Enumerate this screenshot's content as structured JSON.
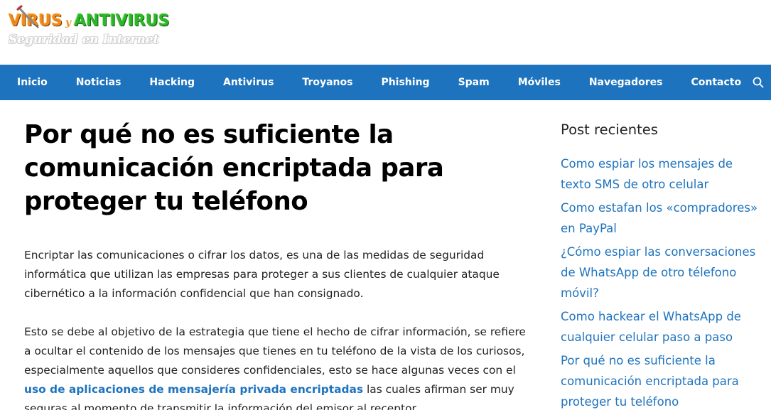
{
  "site": {
    "logo_word1": "VIRUS",
    "logo_joiner": "y",
    "logo_word2": "ANTIVIRUS",
    "tagline": "Seguridad en Internet"
  },
  "colors": {
    "nav_bg": "#1e73be",
    "link": "#1e73be",
    "logo_orange": "#f28a1a",
    "logo_green": "#2fb52a"
  },
  "nav": {
    "items": [
      {
        "label": "Inicio"
      },
      {
        "label": "Noticias"
      },
      {
        "label": "Hacking"
      },
      {
        "label": "Antivirus"
      },
      {
        "label": "Troyanos"
      },
      {
        "label": "Phishing"
      },
      {
        "label": "Spam"
      },
      {
        "label": "Móviles"
      },
      {
        "label": "Navegadores"
      },
      {
        "label": "Contacto"
      }
    ],
    "search_icon": "search-icon"
  },
  "article": {
    "title_lines": [
      "Por qué no es suficiente la",
      "comunicación encriptada para",
      "proteger tu teléfono"
    ],
    "p1_lines": [
      "Encriptar las comunicaciones o cifrar los datos, es una de las medidas de seguridad",
      "informática que utilizan las empresas para proteger a sus clientes de cualquier ataque",
      "cibernético a la información confidencial que han consignado."
    ],
    "p2_lines": [
      "Esto se debe al objetivo de la estrategia que tiene el hecho de cifrar información, se refiere",
      "a ocultar el contenido de los mensajes que tienes en tu teléfono de la vista de los curiosos,",
      "especialmente aquellos que consideres confidenciales, esto se hace algunas veces con el"
    ],
    "p2_link": "uso de aplicaciones de mensajería privada encriptadas",
    "p2_after_link": " las cuales afirman ser muy",
    "p2_last_line": "seguras al momento de transmitir la información del emisor al receptor."
  },
  "sidebar": {
    "title": "Post recientes",
    "posts": [
      {
        "lines": [
          "Como espiar los mensajes de",
          "texto SMS de otro celular"
        ]
      },
      {
        "lines": [
          "Como estafan los «compradores»",
          "en PayPal"
        ]
      },
      {
        "lines": [
          "¿Cómo espiar las conversaciones",
          "de WhatsApp de otro télefono",
          "móvil?"
        ]
      },
      {
        "lines": [
          "Como hackear el WhatsApp de",
          "cualquier celular paso a paso"
        ]
      },
      {
        "lines": [
          "Por qué no es suficiente la",
          "comunicación encriptada para",
          "proteger tu teléfono"
        ]
      }
    ]
  }
}
